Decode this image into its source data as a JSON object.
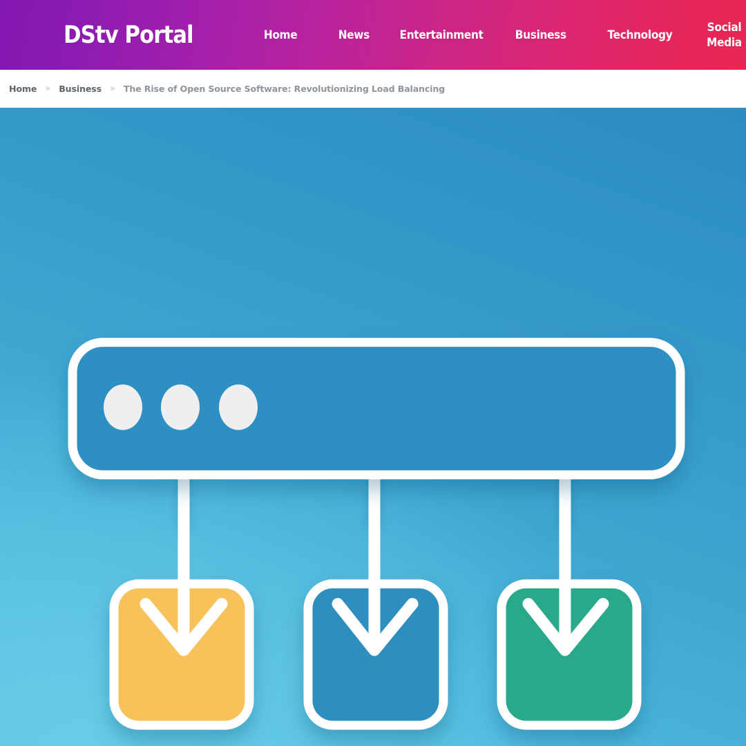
{
  "header": {
    "brand": "DStv Portal",
    "nav": [
      {
        "label": "Home"
      },
      {
        "label": "News"
      },
      {
        "label": "Entertainment"
      },
      {
        "label": "Business"
      },
      {
        "label": "Technology"
      },
      {
        "label": "Social Media"
      }
    ],
    "colors": {
      "gradient_start": "#8418b2",
      "gradient_end": "#e92753",
      "text": "#ffffff"
    }
  },
  "breadcrumb": {
    "separator": "»",
    "items": [
      {
        "label": "Home",
        "current": false
      },
      {
        "label": "Business",
        "current": false
      },
      {
        "label": "The Rise of Open Source Software: Revolutionizing Load Balancing",
        "current": true
      }
    ]
  },
  "hero": {
    "alt": "Load balancer distributing traffic to three backend nodes",
    "background": {
      "top_right": "#2b8cc2",
      "bottom_left": "#58c2e3"
    },
    "diagram": {
      "stroke": "#ffffff",
      "load_balancer": {
        "name": "load-balancer-node",
        "fill": "#2e90c2",
        "dots": 3,
        "dot_color": "#efefef"
      },
      "nodes": [
        {
          "name": "backend-node-1",
          "fill": "#f7c25a"
        },
        {
          "name": "backend-node-2",
          "fill": "#2e8ebe"
        },
        {
          "name": "backend-node-3",
          "fill": "#2ba98a"
        }
      ]
    }
  }
}
